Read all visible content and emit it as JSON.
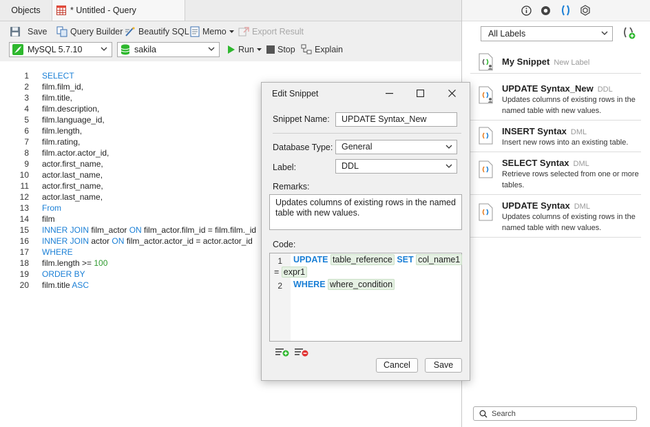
{
  "tabs": {
    "objects": "Objects",
    "query": "* Untitled - Query"
  },
  "toolbar": {
    "save": "Save",
    "query_builder": "Query Builder",
    "beautify": "Beautify SQL",
    "memo": "Memo",
    "export_result": "Export Result",
    "connection": "MySQL 5.7.10",
    "database": "sakila",
    "run": "Run",
    "stop": "Stop",
    "explain": "Explain"
  },
  "editor": {
    "line_numbers": [
      "1",
      "2",
      "3",
      "4",
      "5",
      "6",
      "7",
      "8",
      "9",
      "10",
      "11",
      "12",
      "13",
      "14",
      "15",
      "16",
      "17",
      "18",
      "19",
      "20"
    ],
    "lines": {
      "l1": "SELECT",
      "l2": "film.film_id,",
      "l3": "film.title,",
      "l4": "film.description,",
      "l5": "film.language_id,",
      "l6": "film.length,",
      "l7": "film.rating,",
      "l8": "film.actor.actor_id,",
      "l9": "actor.first_name,",
      "l10": "actor.last_name,",
      "l11": "actor.first_name,",
      "l12": "actor.last_name,",
      "l13": "From",
      "l14": "film",
      "l15_kw1": "INNER JOIN",
      "l15_a": " film_actor ",
      "l15_kw2": "ON",
      "l15_b": " film_actor.film_id = film.film._id",
      "l16_kw1": "INNER JOIN",
      "l16_a": " actor ",
      "l16_kw2": "ON",
      "l16_b": " film_actor.actor_id = actor.actor_id",
      "l17": "WHERE",
      "l18_a": "film.length >= ",
      "l18_num": "100",
      "l19": "ORDER BY",
      "l20_a": "film.title ",
      "l20_kw": "ASC"
    }
  },
  "dialog": {
    "title": "Edit Snippet",
    "snippet_name_label": "Snippet Name:",
    "snippet_name_value": "UPDATE Syntax_New",
    "db_type_label": "Database Type:",
    "db_type_value": "General",
    "label_label": "Label:",
    "label_value": "DDL",
    "remarks_label": "Remarks:",
    "remarks_value": "Updates columns of existing rows in the named table with new values.",
    "code_label": "Code:",
    "code": {
      "ln1": "1",
      "ln2": "2",
      "kw_update": "UPDATE",
      "ph_table_reference": "table_reference",
      "kw_set": "SET",
      "ph_col_name1": "col_name1",
      "eq": "=",
      "ph_expr1": "expr1",
      "kw_where": "WHERE",
      "ph_where_condition": "where_condition"
    },
    "cancel": "Cancel",
    "save": "Save"
  },
  "sidebar": {
    "label_filter": "All Labels",
    "snippets": [
      {
        "title": "My Snippet",
        "label": "New Label",
        "desc": ""
      },
      {
        "title": "UPDATE Syntax_New",
        "label": "DDL",
        "desc": "Updates columns of existing rows in the named table with new values."
      },
      {
        "title": "INSERT Syntax",
        "label": "DML",
        "desc": "Insert new rows into an existing table."
      },
      {
        "title": "SELECT Syntax",
        "label": "DML",
        "desc": "Retrieve rows selected from one or more tables."
      },
      {
        "title": "UPDATE Syntax",
        "label": "DML",
        "desc": "Updates columns of existing rows in the named table with new values."
      }
    ],
    "search_placeholder": "Search"
  }
}
